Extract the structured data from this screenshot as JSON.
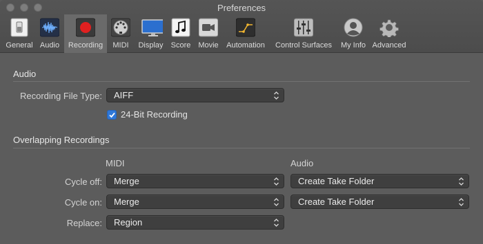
{
  "window": {
    "title": "Preferences"
  },
  "toolbar": {
    "tabs": [
      {
        "label": "General",
        "icon": "switch-icon"
      },
      {
        "label": "Audio",
        "icon": "waveform-icon"
      },
      {
        "label": "Recording",
        "icon": "record-icon",
        "active": true
      },
      {
        "label": "MIDI",
        "icon": "midi-port-icon"
      },
      {
        "label": "Display",
        "icon": "monitor-icon"
      },
      {
        "label": "Score",
        "icon": "score-icon"
      },
      {
        "label": "Movie",
        "icon": "camera-icon"
      },
      {
        "label": "Automation",
        "icon": "automation-icon"
      },
      {
        "label": "Control Surfaces",
        "icon": "faders-icon"
      },
      {
        "label": "My Info",
        "icon": "user-icon"
      },
      {
        "label": "Advanced",
        "icon": "gear-icon"
      }
    ]
  },
  "audio": {
    "section_title": "Audio",
    "file_type_label": "Recording File Type:",
    "file_type_value": "AIFF",
    "bit24_label": "24-Bit Recording",
    "bit24_checked": true
  },
  "overlap": {
    "section_title": "Overlapping Recordings",
    "col_midi": "MIDI",
    "col_audio": "Audio",
    "cycle_off_label": "Cycle off:",
    "cycle_off_midi": "Merge",
    "cycle_off_audio": "Create Take Folder",
    "cycle_on_label": "Cycle on:",
    "cycle_on_midi": "Merge",
    "cycle_on_audio": "Create Take Folder",
    "replace_label": "Replace:",
    "replace_midi": "Region"
  },
  "colors": {
    "accent": "#2f78d9",
    "record": "#e02020"
  }
}
